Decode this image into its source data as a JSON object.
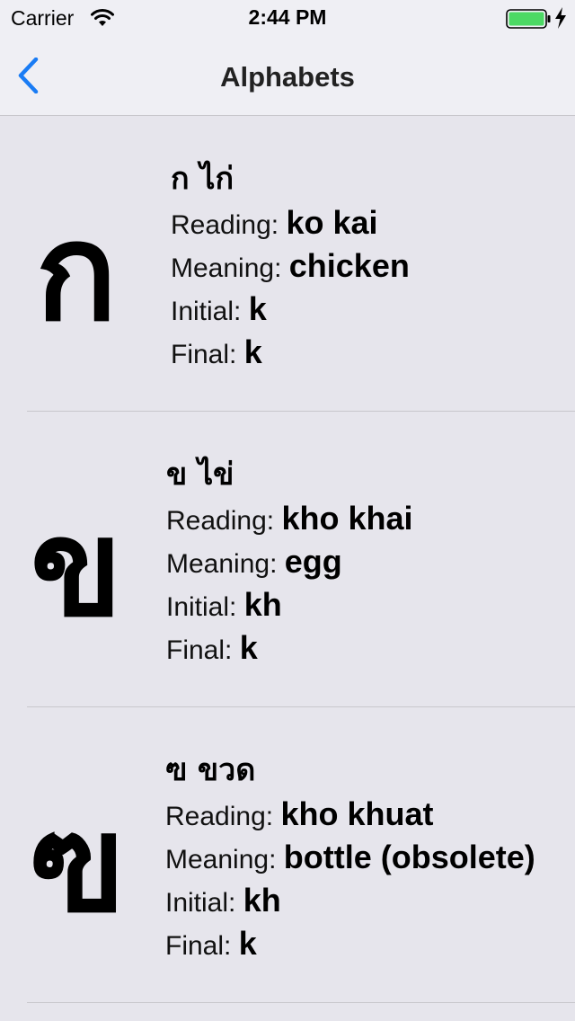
{
  "status_bar": {
    "carrier": "Carrier",
    "time": "2:44 PM",
    "battery_color": "#4cd964"
  },
  "nav": {
    "title": "Alphabets",
    "back_icon": "chevron-left-icon",
    "accent_color": "#1a7cf4"
  },
  "labels": {
    "reading": "Reading:",
    "meaning": "Meaning:",
    "initial": "Initial:",
    "final": "Final:"
  },
  "rows": [
    {
      "letter": "ก",
      "thai_name": "ก ไก่",
      "reading": "ko kai",
      "meaning": "chicken",
      "initial": "k",
      "final": "k"
    },
    {
      "letter": "ข",
      "thai_name": "ข ไข่",
      "reading": "kho khai",
      "meaning": "egg",
      "initial": "kh",
      "final": "k"
    },
    {
      "letter": "ฃ",
      "thai_name": "ฃ ขวด",
      "reading": "kho khuat",
      "meaning": "bottle (obsolete)",
      "initial": "kh",
      "final": "k"
    }
  ]
}
